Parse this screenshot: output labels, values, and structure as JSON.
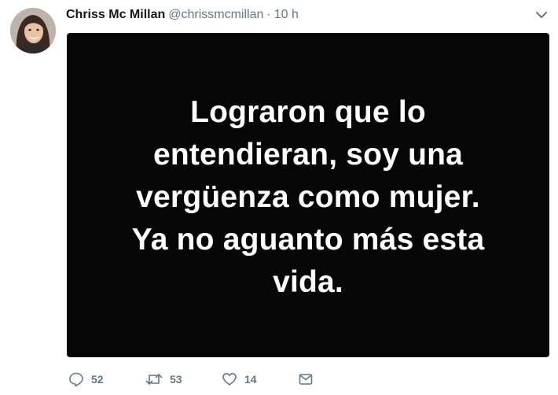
{
  "tweet": {
    "display_name": "Chriss Mc Millan",
    "handle": "@chrissmcmillan",
    "separator": "·",
    "time": "10 h",
    "media_lines": [
      "Lograron que lo",
      "entendieran, soy una",
      "vergüenza como mujer.",
      "Ya no aguanto más esta",
      "vida."
    ],
    "actions": {
      "reply_count": "52",
      "retweet_count": "53",
      "like_count": "14"
    }
  },
  "icons": {
    "menu": "chevron-down-icon",
    "reply": "reply-icon",
    "retweet": "retweet-icon",
    "like": "heart-icon",
    "message": "envelope-icon"
  },
  "colors": {
    "name": "#14171a",
    "secondary": "#657786",
    "media_background": "#060606",
    "media_text": "#ffffff"
  }
}
